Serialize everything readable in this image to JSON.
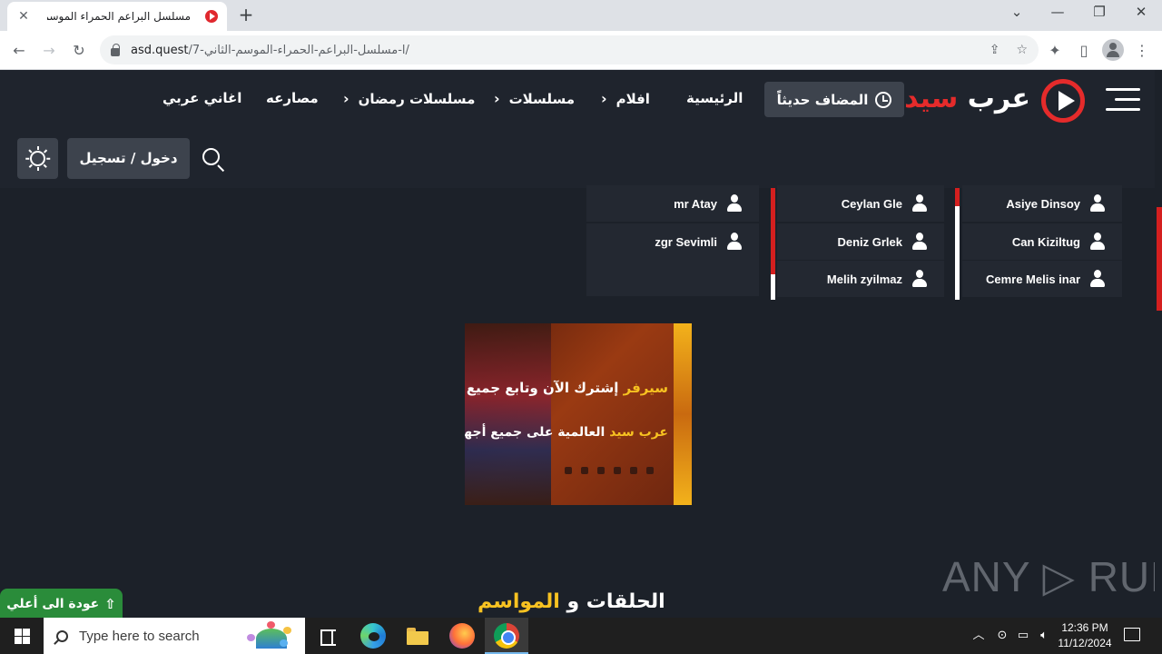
{
  "browser": {
    "tab_title": "مسلسل البراعم الحمراء الموسم الثا",
    "tab_close": "✕",
    "new_tab": "+",
    "url_host": "asd.quest",
    "url_path": "/7-ا-مسلسل-البراعم-الحمراء-الموسم-الثاني/",
    "window_min": "⌄",
    "window_minimize": "—",
    "window_restore": "❐",
    "window_close": "✕"
  },
  "site": {
    "logo_word1": "عرب",
    "logo_word2": "سيد",
    "recent_label": "المضاف حديثاً",
    "nav": {
      "home": "الرئيسية",
      "movies": "افلام",
      "series": "مسلسلات",
      "ramadan": "مسلسلات رمضان",
      "wrestling": "مصارعه",
      "songs": "اغاني عربي"
    },
    "login_label": "دخول / تسجيل"
  },
  "cast": {
    "col1": [
      "Asiye Dinsoy",
      "Can Kiziltug",
      "Cemre Melis inar"
    ],
    "col2": [
      "Ceylan Gle",
      "Deniz Grlek",
      "Melih zyilmaz"
    ],
    "col3": [
      "mr Atay",
      "zgr Sevimli"
    ]
  },
  "ad": {
    "line1_hl": "سيرفر",
    "line1": "إشترك الآن وتابع جميع الدوريات",
    "line2_hl": "عرب سيد",
    "line2": "العالمية على جميع أجهزتك الرقمية"
  },
  "section": {
    "word1": "الحلقات و",
    "word2": "المواسم"
  },
  "back_to_top": "عودة الى أعلي",
  "watermark": "ANY ▷ RUN",
  "taskbar": {
    "search_placeholder": "Type here to search",
    "time": "12:36 PM",
    "date": "11/12/2024"
  },
  "colors": {
    "accent_red": "#e52b2b",
    "accent_yellow": "#f7c221",
    "header_bg": "#1f242d",
    "page_bg": "#1c2129",
    "back_top_green": "#2a8c3a"
  }
}
